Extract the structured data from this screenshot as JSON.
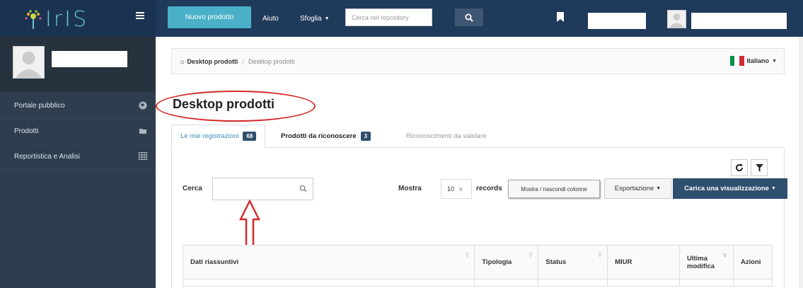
{
  "topbar": {
    "logo_text": "IrIS",
    "new_product": "Nuovo prodotto",
    "help": "Aiuto",
    "browse": "Sfoglia",
    "search_placeholder": "Cerca nel repository"
  },
  "sidebar": {
    "items": [
      {
        "label": "Portale pubblico",
        "icon": "globe-icon"
      },
      {
        "label": "Prodotti",
        "icon": "folder-icon"
      },
      {
        "label": "Reportistica e Analisi",
        "icon": "table-icon"
      }
    ]
  },
  "breadcrumb": {
    "home": "Desktop prodotti",
    "current": "Desktop prodotti"
  },
  "language": "Italiano",
  "page_title": "Desktop prodotti",
  "tabs": [
    {
      "label": "Le mie registrazioni",
      "badge": "68"
    },
    {
      "label": "Prodotti da riconoscere",
      "badge": "3"
    },
    {
      "label": "Riconoscimenti da validare"
    }
  ],
  "toolbar": {
    "search_label": "Cerca",
    "show_label": "Mostra",
    "page_size": "10",
    "records_label": "records",
    "toggle_columns": "Mostra / nascondi colonne",
    "export": "Esportazione",
    "load_view": "Carica una visualizzazione"
  },
  "table": {
    "headers": [
      "Dati riassuntivi",
      "Tipologia",
      "Status",
      "MIUR",
      "Ultima modifica",
      "Azioni"
    ]
  },
  "colors": {
    "topbar": "#1f3a5a",
    "accent": "#4ab0c8",
    "sidebar": "#2e3e4e",
    "annotation": "#d42a2a"
  }
}
